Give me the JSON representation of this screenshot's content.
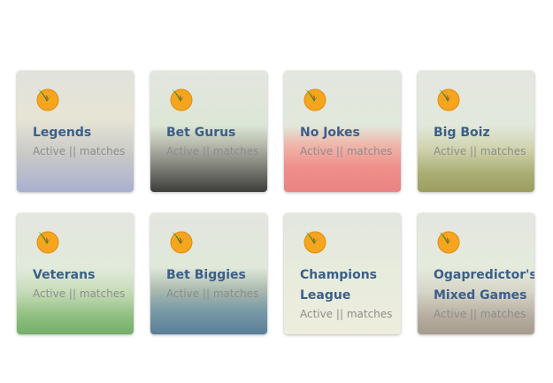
{
  "cards": [
    {
      "name": "Legends",
      "status": "Active || matches"
    },
    {
      "name": "Bet Gurus",
      "status": "Active || matches"
    },
    {
      "name": "No Jokes",
      "status": "Active || matches"
    },
    {
      "name": "Big Boiz",
      "status": "Active || matches"
    },
    {
      "name": "Veterans",
      "status": "Active || matches"
    },
    {
      "name": "Bet Biggies",
      "status": "Active || matches"
    },
    {
      "name": "Champions League",
      "status": "Active || matches"
    },
    {
      "name": "Ogapredictor's Mixed Games",
      "status": "Active || matches"
    }
  ],
  "logo_icon": "orange-ball-with-green-check-icon",
  "colors": {
    "title": "#3b5f8a",
    "status": "#8d8d8d",
    "logo_orange": "#f5a623",
    "logo_green": "#3f9b2e"
  }
}
